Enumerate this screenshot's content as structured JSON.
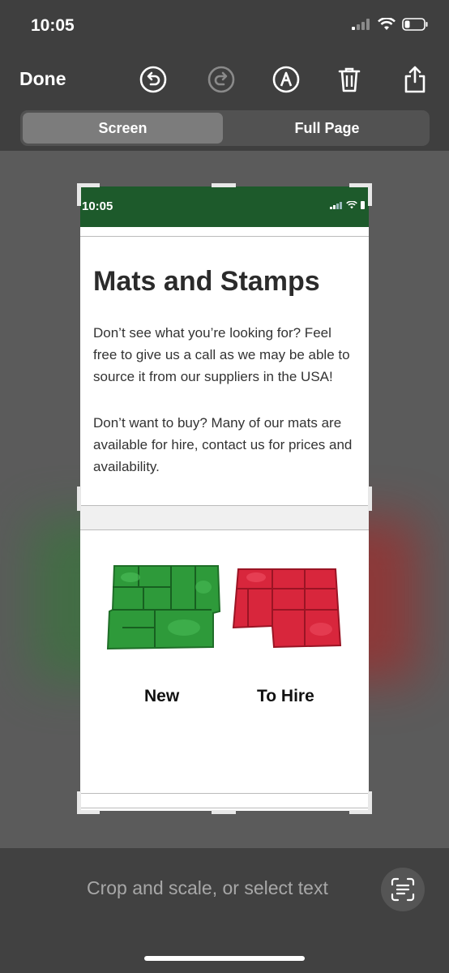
{
  "status_bar": {
    "time": "10:05"
  },
  "toolbar": {
    "done_label": "Done",
    "icons": [
      "undo-icon",
      "redo-icon",
      "markup-icon",
      "trash-icon",
      "share-icon"
    ]
  },
  "segments": {
    "screen_label": "Screen",
    "full_page_label": "Full Page",
    "selected": "Screen"
  },
  "preview": {
    "status_time": "10:05",
    "header_color": "#1d5a2b",
    "title": "Mats and Stamps",
    "paragraph1": "Don’t see what you’re looking for? Feel free to give us a call as we may be able to source it from our suppliers in the USA!",
    "paragraph2": "Don’t want to buy? Many of our mats are available for hire, contact us for prices and availability.",
    "mats": [
      {
        "label": "New",
        "color": "#2e9a3a"
      },
      {
        "label": "To Hire",
        "color": "#d8263c"
      }
    ]
  },
  "bottom": {
    "hint": "Crop and scale, or select text"
  }
}
